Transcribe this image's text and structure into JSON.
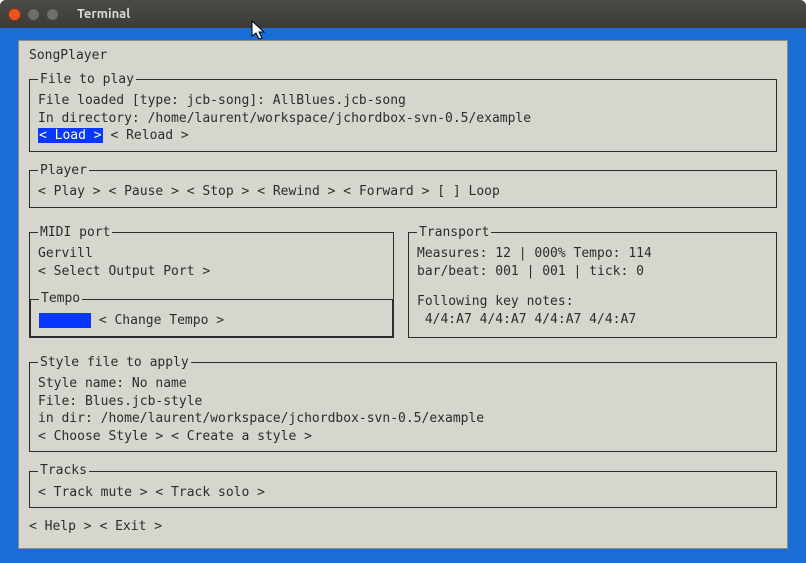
{
  "window": {
    "title": "Terminal"
  },
  "app": {
    "title": "SongPlayer"
  },
  "fileToPlay": {
    "legend": "File to play",
    "loaded_line": "File loaded [type: jcb-song]: AllBlues.jcb-song",
    "dir_line": "In directory: /home/laurent/workspace/jchordbox-svn-0.5/example",
    "load_label": "< Load >",
    "reload_label": "< Reload >"
  },
  "player": {
    "legend": "Player",
    "play": "< Play >",
    "pause": "< Pause >",
    "stop": "< Stop >",
    "rewind": "< Rewind >",
    "forward": "< Forward >",
    "loop": "[ ] Loop"
  },
  "midi": {
    "legend": "MIDI port",
    "device": "Gervill",
    "select": "< Select Output Port >"
  },
  "transport": {
    "legend": "Transport",
    "line1": "Measures: 12  | 000% Tempo: 114",
    "line2": "bar/beat: 001 | 001 | tick: 0",
    "notes_header": "Following key notes:",
    "notes": " 4/4:A7 4/4:A7 4/4:A7 4/4:A7"
  },
  "tempo": {
    "legend": "Tempo",
    "change": "< Change Tempo >"
  },
  "style": {
    "legend": "Style file to apply",
    "name_line": "Style name: No name",
    "file_line": "File: Blues.jcb-style",
    "dir_line": "in dir: /home/laurent/workspace/jchordbox-svn-0.5/example",
    "choose": "< Choose Style >",
    "create": "< Create a style >"
  },
  "tracks": {
    "legend": "Tracks",
    "mute": "< Track mute >",
    "solo": "< Track solo >"
  },
  "footer": {
    "help": "< Help >",
    "exit": "< Exit >"
  }
}
